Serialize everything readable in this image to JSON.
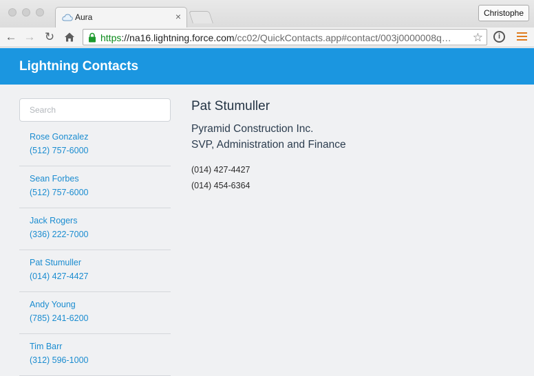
{
  "browser": {
    "tab_title": "Aura",
    "tab_close": "×",
    "profile_name": "Christophe",
    "url_scheme": "https",
    "url_sep": "://",
    "url_host": "na16.lightning.force.com",
    "url_path": "/cc02/QuickContacts.app#contact/003j0000008q…",
    "icons": [
      "back-icon",
      "forward-icon",
      "reload-icon",
      "home-icon",
      "lock-icon",
      "star-icon",
      "info-icon",
      "menu-icon"
    ]
  },
  "app": {
    "title": "Lightning Contacts",
    "header_color": "#1b96e0",
    "search_placeholder": "Search"
  },
  "contacts": [
    {
      "name": "Rose Gonzalez",
      "phone": "(512) 757-6000"
    },
    {
      "name": "Sean Forbes",
      "phone": "(512) 757-6000"
    },
    {
      "name": "Jack Rogers",
      "phone": "(336) 222-7000"
    },
    {
      "name": "Pat Stumuller",
      "phone": "(014) 427-4427"
    },
    {
      "name": "Andy Young",
      "phone": "(785) 241-6200"
    },
    {
      "name": "Tim Barr",
      "phone": "(312) 596-1000"
    }
  ],
  "selected_contact": {
    "name": "Pat Stumuller",
    "company": "Pyramid Construction Inc.",
    "title": "SVP, Administration and Finance",
    "phone": "(014) 427-4427",
    "mobile": "(014) 454-6364"
  }
}
